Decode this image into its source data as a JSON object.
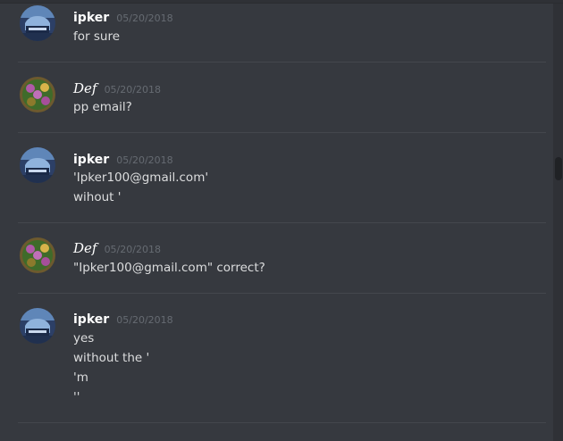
{
  "messages": [
    {
      "username": "ipker",
      "timestamp": "05/20/2018",
      "lines": [
        "for sure"
      ]
    },
    {
      "username": "Def",
      "timestamp": "05/20/2018",
      "lines": [
        "pp email?"
      ]
    },
    {
      "username": "ipker",
      "timestamp": "05/20/2018",
      "lines": [
        "'Ipker100@gmail.com'",
        "wihout '"
      ]
    },
    {
      "username": "Def",
      "timestamp": "05/20/2018",
      "lines": [
        "\"Ipker100@gmail.com\" correct?"
      ]
    },
    {
      "username": "ipker",
      "timestamp": "05/20/2018",
      "lines": [
        "yes",
        "without the '",
        "'m",
        "''"
      ]
    }
  ],
  "colors": {
    "background": "#36393f",
    "username": "#ffffff",
    "timestamp": "#666b72",
    "text": "#dcddde",
    "divider": "#44474d"
  },
  "icons": {
    "ipker_avatar": "car-avatar-icon",
    "def_avatar": "mosaic-avatar-icon"
  }
}
